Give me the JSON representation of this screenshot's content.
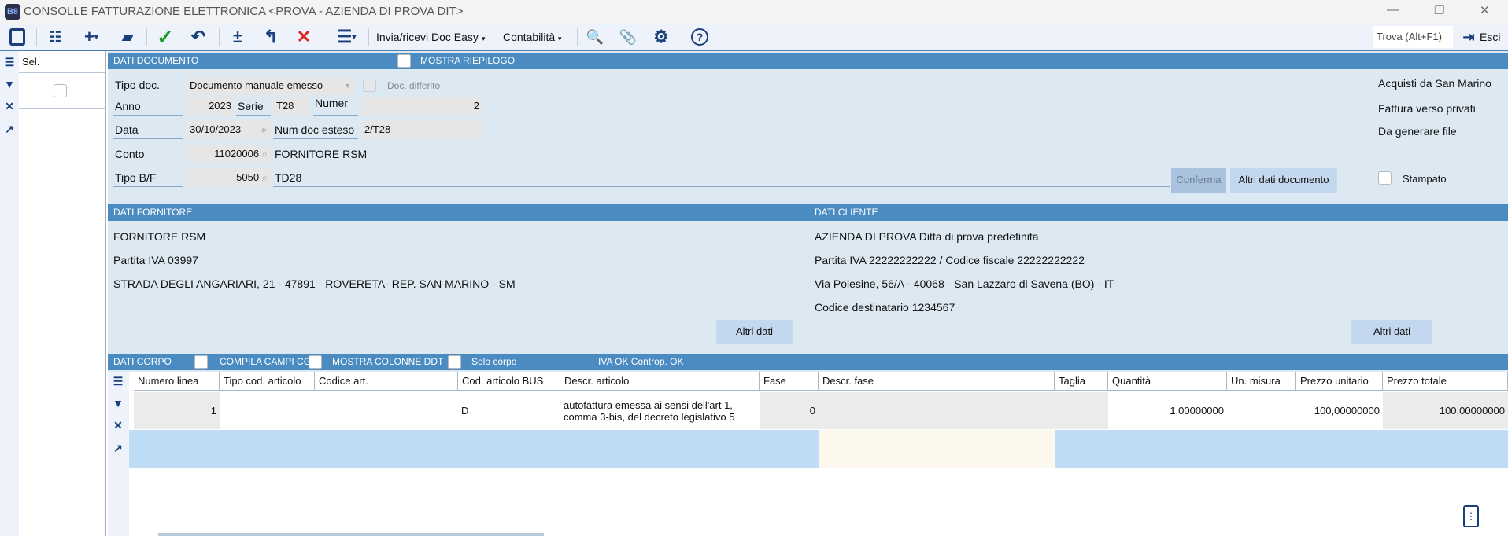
{
  "window": {
    "title": "CONSOLLE FATTURAZIONE ELETTRONICA <PROVA - AZIENDA DI PROVA DIT>",
    "logo": "B8",
    "minimize": "—",
    "restore": "❐",
    "close": "✕"
  },
  "toolbar": {
    "invia": "Invia/ricevi Doc Easy",
    "contabilita": "Contabilità",
    "trova": "Trova (Alt+F1)",
    "esci": "Esci"
  },
  "sidebar": {
    "sel_header": "Sel."
  },
  "dati_documento": {
    "header": "DATI DOCUMENTO",
    "mostra_riepilogo": "MOSTRA RIEPILOGO",
    "tipo_doc_label": "Tipo doc.",
    "tipo_doc_value": "Documento manuale emesso",
    "doc_differito": "Doc. differito",
    "anno_label": "Anno",
    "anno_value": "2023",
    "serie_label": "Serie",
    "serie_value": "T28",
    "numer_label": "Numer",
    "numer_value": "2",
    "data_label": "Data",
    "data_value": "30/10/2023",
    "num_doc_esteso_label": "Num doc esteso",
    "num_doc_esteso_value": "2/T28",
    "conto_label": "Conto",
    "conto_value": "11020006",
    "conto_desc": "FORNITORE RSM",
    "tipo_bf_label": "Tipo B/F",
    "tipo_bf_value": "5050",
    "tipo_bf_desc": "TD28",
    "conferma": "Conferma",
    "altri_dati_documento": "Altri dati documento",
    "flags": [
      "Acquisti da San Marino",
      "Fattura verso privati",
      "Da generare file"
    ],
    "stampato": "Stampato"
  },
  "dati_fornitore": {
    "header": "DATI FORNITORE",
    "lines": [
      "FORNITORE RSM",
      "Partita IVA 03997",
      "STRADA DEGLI ANGARIARI, 21 - 47891 - ROVERETA- REP. SAN MARINO - SM"
    ],
    "altri_dati": "Altri dati"
  },
  "dati_cliente": {
    "header": "DATI CLIENTE",
    "lines": [
      "AZIENDA DI PROVA Ditta di prova predefinita",
      "Partita IVA 22222222222 / Codice fiscale 22222222222",
      "Via Polesine, 56/A - 40068 - San Lazzaro di Savena (BO)  - IT",
      "Codice destinatario 1234567"
    ],
    "altri_dati": "Altri dati"
  },
  "dati_corpo": {
    "header": "DATI CORPO",
    "compila": "COMPILA CAMPI CG",
    "mostra_ddt": "MOSTRA COLONNE DDT",
    "solo_corpo": "Solo corpo",
    "status": "IVA OK Controp. OK"
  },
  "table": {
    "columns": [
      "Numero linea",
      "Tipo cod. articolo",
      "Codice art.",
      "Cod. articolo BUS",
      "Descr. articolo",
      "Fase",
      "Descr. fase",
      "Taglia",
      "Quantità",
      "Un. misura",
      "Prezzo unitario",
      "Prezzo totale"
    ],
    "rows": [
      [
        "1",
        "",
        "",
        "D",
        "autofattura emessa ai sensi dell'art 1, comma 3-bis, del decreto legislativo 5",
        "0",
        "",
        "",
        "1,00000000",
        "",
        "100,00000000",
        "100,00000000"
      ]
    ]
  }
}
